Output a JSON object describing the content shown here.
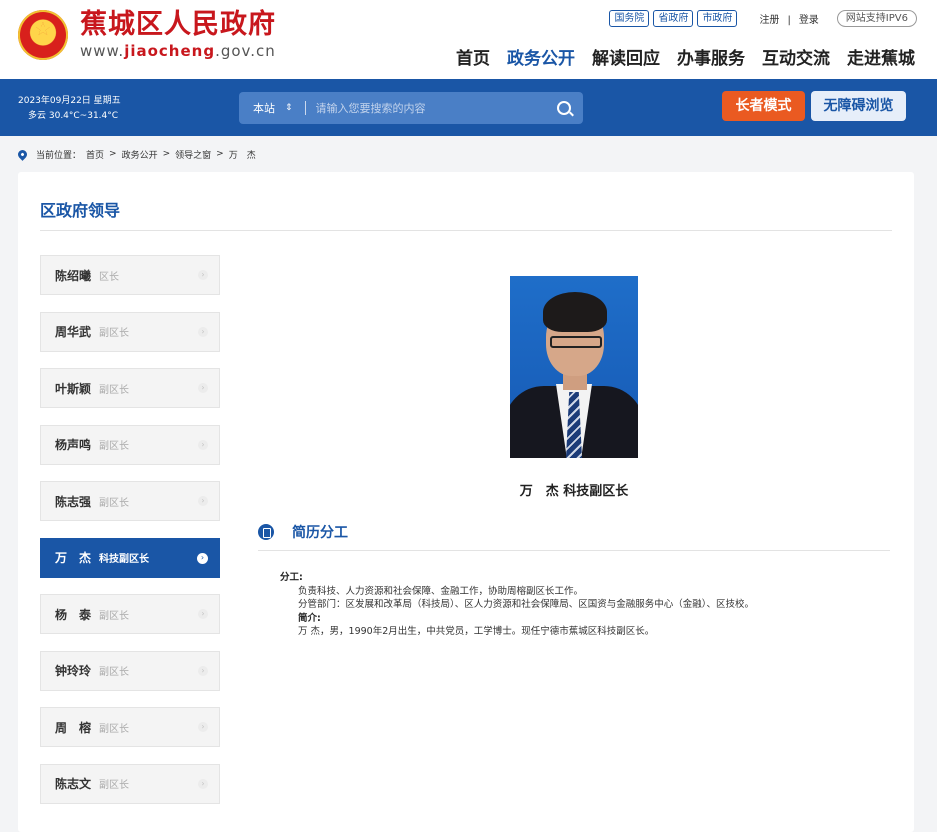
{
  "header": {
    "site_name": "蕉城区人民政府",
    "url_prefix": "www.",
    "url_brand": "jiaocheng",
    "url_suffix": ".gov.cn",
    "gov_links": [
      "国务院",
      "省政府",
      "市政府"
    ],
    "register": "注册",
    "divider": "|",
    "login": "登录",
    "ipv6": "网站支持IPV6",
    "nav": [
      "首页",
      "政务公开",
      "解读回应",
      "办事服务",
      "互动交流",
      "走进蕉城"
    ],
    "nav_active": "政务公开"
  },
  "bar": {
    "date": "2023年09月22日 星期五",
    "weather": "多云 30.4°C~31.4°C",
    "search_scope": "本站",
    "search_scope_arrow": "⇕",
    "search_placeholder": "请输入您要搜索的内容",
    "elder_mode": "长者模式",
    "accessible": "无障碍浏览"
  },
  "breadcrumb": {
    "label": "当前位置：",
    "items": [
      "首页",
      ">",
      "政务公开",
      ">",
      "领导之窗",
      ">",
      "万　杰"
    ]
  },
  "main": {
    "title": "区政府领导",
    "leaders": [
      {
        "name": "陈绍曦",
        "title": "区长"
      },
      {
        "name": "周华武",
        "title": "副区长"
      },
      {
        "name": "叶斯颖",
        "title": "副区长"
      },
      {
        "name": "杨声鸣",
        "title": "副区长"
      },
      {
        "name": "陈志强",
        "title": "副区长"
      },
      {
        "name": "万　杰",
        "title": "科技副区长",
        "active": true
      },
      {
        "name": "杨　泰",
        "title": "副区长"
      },
      {
        "name": "钟玲玲",
        "title": "副区长"
      },
      {
        "name": "周　榕",
        "title": "副区长"
      },
      {
        "name": "陈志文",
        "title": "副区长"
      }
    ],
    "chevron": "›",
    "person_name": "万　杰",
    "person_title": "科技副区长",
    "section_title": "简历分工",
    "duty_label": "分工:",
    "duty_text": "负责科技、人力资源和社会保障、金融工作，协助周榕副区长工作。",
    "dept_text": "分管部门：区发展和改革局（科技局）、区人力资源和社会保障局、区国资与金融服务中心（金融）、区技校。",
    "bio_label": "简介:",
    "bio_text": "万 杰，男，1990年2月出生，中共党员，工学博士。现任宁德市蕉城区科技副区长。"
  }
}
